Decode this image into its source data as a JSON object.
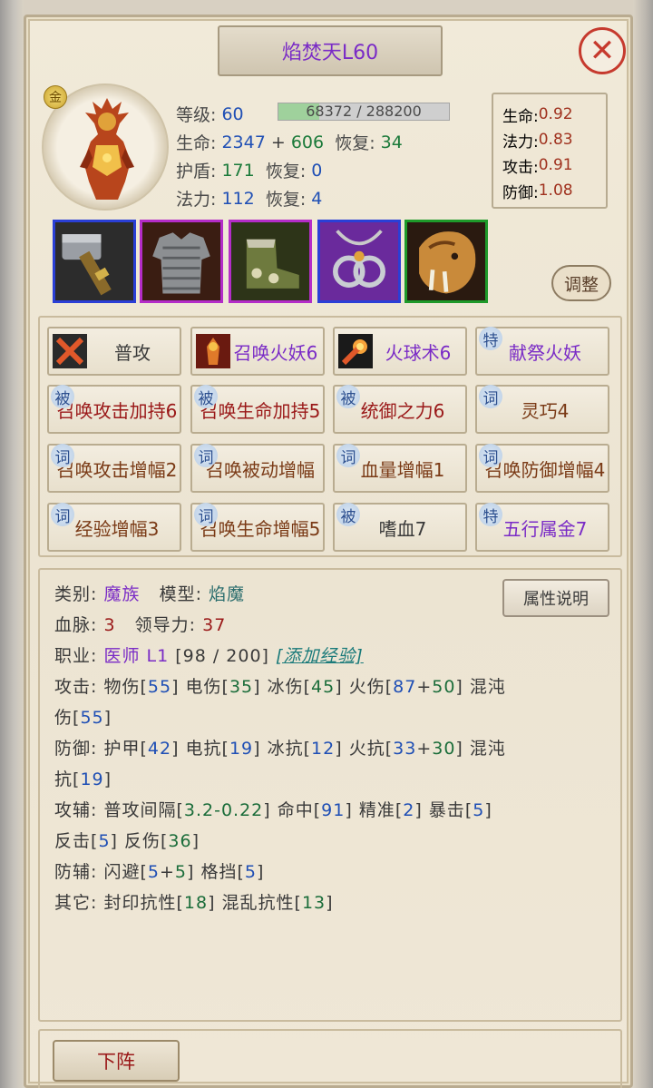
{
  "title": "焰焚天L60",
  "close_icon": "close-icon",
  "portrait": {
    "badge": "金",
    "icon": "flame-demon-portrait"
  },
  "stats": {
    "level_label": "等级:",
    "level": "60",
    "xp_text": "68372 / 288200",
    "xp_current": 68372,
    "xp_max": 288200,
    "hp_label": "生命:",
    "hp": "2347",
    "hp_plus": "+",
    "hp_bonus": "606",
    "hp_regen_label": "恢复:",
    "hp_regen": "34",
    "shield_label": "护盾:",
    "shield": "171",
    "shield_regen_label": "恢复:",
    "shield_regen": "0",
    "mp_label": "法力:",
    "mp": "112",
    "mp_regen_label": "恢复:",
    "mp_regen": "4"
  },
  "growth": [
    {
      "label": "生命:",
      "value": "0.92"
    },
    {
      "label": "法力:",
      "value": "0.83"
    },
    {
      "label": "攻击:",
      "value": "0.91"
    },
    {
      "label": "防御:",
      "value": "1.08"
    }
  ],
  "equipment": [
    {
      "name": "hammer-icon",
      "border": "#2a3fd6"
    },
    {
      "name": "chainmail-icon",
      "border": "#b42cc8"
    },
    {
      "name": "boots-icon",
      "border": "#b42cc8"
    },
    {
      "name": "amulet-icon",
      "border": "#2a3fd6"
    },
    {
      "name": "beast-helm-icon",
      "border": "#1e9a2a"
    }
  ],
  "adjust_label": "调整",
  "skills": [
    {
      "tag": "",
      "label": "普攻",
      "color": "dark",
      "icon": "crossed-swords-icon"
    },
    {
      "tag": "",
      "label": "召唤火妖6",
      "color": "purple",
      "icon": "fire-demon-icon"
    },
    {
      "tag": "",
      "label": "火球术6",
      "color": "purple",
      "icon": "fireball-icon"
    },
    {
      "tag": "特",
      "label": "献祭火妖",
      "color": "purple",
      "icon": ""
    },
    {
      "tag": "被",
      "label": "召唤攻击加持6",
      "color": "red",
      "icon": ""
    },
    {
      "tag": "被",
      "label": "召唤生命加持5",
      "color": "red",
      "icon": ""
    },
    {
      "tag": "被",
      "label": "统御之力6",
      "color": "red",
      "icon": ""
    },
    {
      "tag": "词",
      "label": "灵巧4",
      "color": "brown",
      "icon": ""
    },
    {
      "tag": "词",
      "label": "召唤攻击增幅2",
      "color": "brown",
      "icon": ""
    },
    {
      "tag": "词",
      "label": "召唤被动增幅",
      "color": "brown",
      "icon": ""
    },
    {
      "tag": "词",
      "label": "血量增幅1",
      "color": "brown",
      "icon": ""
    },
    {
      "tag": "词",
      "label": "召唤防御增幅4",
      "color": "brown",
      "icon": ""
    },
    {
      "tag": "词",
      "label": "经验增幅3",
      "color": "brown",
      "icon": ""
    },
    {
      "tag": "词",
      "label": "召唤生命增幅5",
      "color": "brown",
      "icon": ""
    },
    {
      "tag": "被",
      "label": "嗜血7",
      "color": "dark",
      "icon": ""
    },
    {
      "tag": "特",
      "label": "五行属金7",
      "color": "purple",
      "icon": ""
    }
  ],
  "attributes": {
    "category_label": "类别:",
    "category": "魔族",
    "model_label": "模型:",
    "model": "焰魔",
    "bloodline_label": "血脉:",
    "bloodline": "3",
    "leadership_label": "领导力:",
    "leadership": "37",
    "job_label": "职业:",
    "job": "医师 L1",
    "job_xp": "[98 / 200]",
    "add_xp": "[添加经验]",
    "attack_label": "攻击:",
    "defense_label": "防御:",
    "atk_aux_label": "攻辅:",
    "def_aux_label": "防辅:",
    "other_label": "其它:",
    "help_button": "属性说明"
  },
  "attack": {
    "phys": "物伤",
    "phys_v": "55",
    "elec": "电伤",
    "elec_v": "35",
    "ice": "冰伤",
    "ice_v": "45",
    "fire": "火伤",
    "fire_v1": "87",
    "fire_plus": "+",
    "fire_v2": "50",
    "chaos": "混沌",
    "chaos2": "伤",
    "chaos_v": "55"
  },
  "defense": {
    "armor": "护甲",
    "armor_v": "42",
    "elec": "电抗",
    "elec_v": "19",
    "ice": "冰抗",
    "ice_v": "12",
    "fire": "火抗",
    "fire_v1": "33",
    "fire_plus": "+",
    "fire_v2": "30",
    "chaos": "混沌",
    "chaos2": "抗",
    "chaos_v": "19"
  },
  "atk_aux": {
    "interval": "普攻间隔",
    "interval_v": "3.2-0.22",
    "hit": "命中",
    "hit_v": "91",
    "precision": "精准",
    "precision_v": "2",
    "crit": "暴击",
    "crit_v": "5",
    "counter": "反击",
    "counter_v": "5",
    "reflect": "反伤",
    "reflect_v": "36"
  },
  "def_aux": {
    "dodge": "闪避",
    "dodge_v1": "5",
    "dodge_plus": "+",
    "dodge_v2": "5",
    "block": "格挡",
    "block_v": "5"
  },
  "other": {
    "seal": "封印抗性",
    "seal_v": "18",
    "confuse": "混乱抗性",
    "confuse_v": "13"
  },
  "bottom_button": "下阵"
}
